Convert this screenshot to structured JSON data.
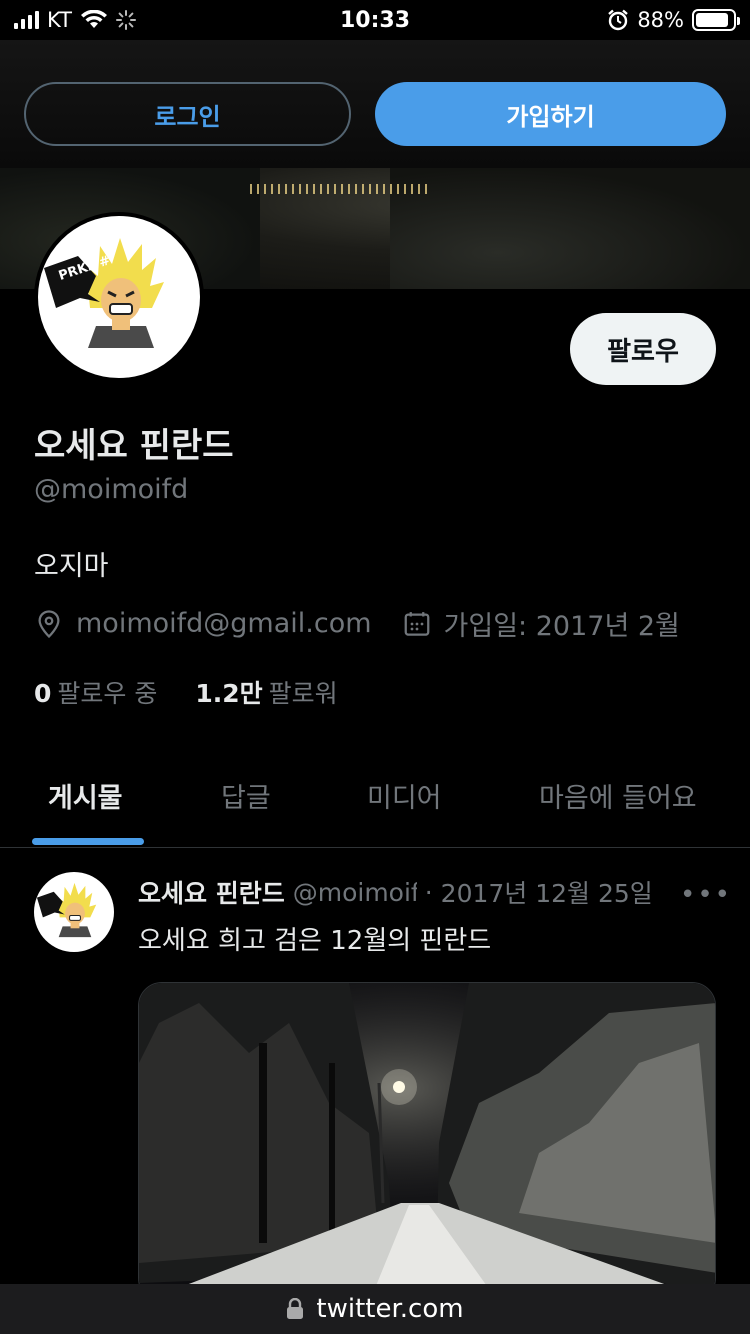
{
  "status_bar": {
    "carrier": "KT",
    "time": "10:33",
    "battery_percent": "88%",
    "battery_level": 0.88
  },
  "auth": {
    "login_label": "로그인",
    "signup_label": "가입하기"
  },
  "profile": {
    "avatar_text": "PRKL #",
    "follow_label": "팔로우",
    "display_name": "오세요 핀란드",
    "handle": "@moimoifd",
    "bio": "오지마",
    "location_icon": "location-pin-icon",
    "location": "moimoifd@gmail.com",
    "joined_icon": "calendar-icon",
    "joined": "가입일: 2017년 2월",
    "following_count": "0",
    "following_label": "팔로우 중",
    "followers_count": "1.2만",
    "followers_label": "팔로워"
  },
  "tabs": [
    {
      "label": "게시물",
      "active": true
    },
    {
      "label": "답글",
      "active": false
    },
    {
      "label": "미디어",
      "active": false
    },
    {
      "label": "마음에 들어요",
      "active": false
    }
  ],
  "tweet": {
    "author_name": "오세요 핀란드",
    "author_handle": "@moimoifd",
    "separator": "·",
    "date": "2017년 12월 25일",
    "more_icon": "more-dots-icon",
    "text": "오세요 희고 검은 12월의 핀란드",
    "media_description": "snowy forest road at night"
  },
  "url_bar": {
    "lock_icon": "lock-icon",
    "domain": "twitter.com"
  },
  "colors": {
    "accent": "#4a9de9",
    "background": "#000000",
    "secondary_text": "#71767b",
    "primary_text": "#e7e9ea"
  }
}
